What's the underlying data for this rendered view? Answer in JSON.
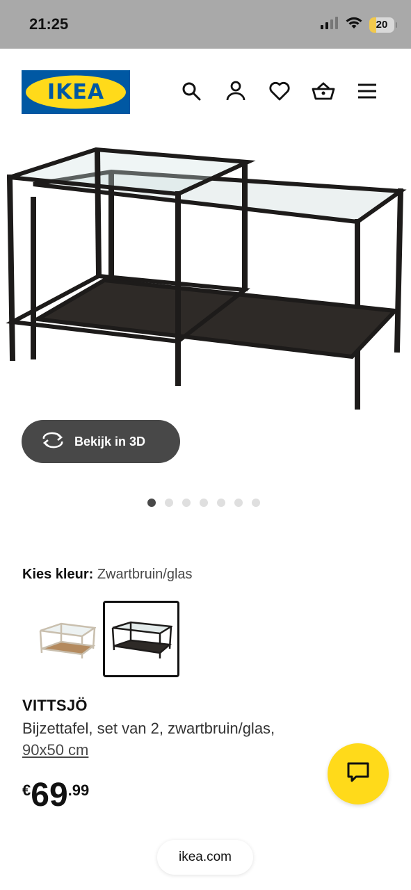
{
  "status_bar": {
    "time": "21:25",
    "battery_level": "20",
    "icons": [
      "signal-icon",
      "wifi-icon",
      "battery-icon"
    ]
  },
  "header": {
    "logo_text": "IKEA",
    "icons": [
      "search-icon",
      "account-icon",
      "wishlist-heart-icon",
      "shopping-basket-icon",
      "menu-icon"
    ]
  },
  "gallery": {
    "view_3d_label": "Bekijk in 3D",
    "dot_count": 7,
    "active_dot": 1
  },
  "color_select": {
    "label": "Kies kleur:",
    "value": "Zwartbruin/glas",
    "options": [
      "white-stained-oak-glass",
      "black-brown-glass"
    ],
    "selected_index": 1
  },
  "product": {
    "name": "VITTSJÖ",
    "description": "Bijzettafel, set van 2, zwartbruin/glas,",
    "size": "90x50 cm",
    "price_currency": "€",
    "price_integer": "69",
    "price_decimal": ".99"
  },
  "browser": {
    "url": "ikea.com"
  },
  "colors": {
    "status_bar_bg": "#a9a9a9",
    "ikea_blue": "#0058a3",
    "ikea_yellow": "#ffda1a",
    "button_dark": "#484848"
  }
}
